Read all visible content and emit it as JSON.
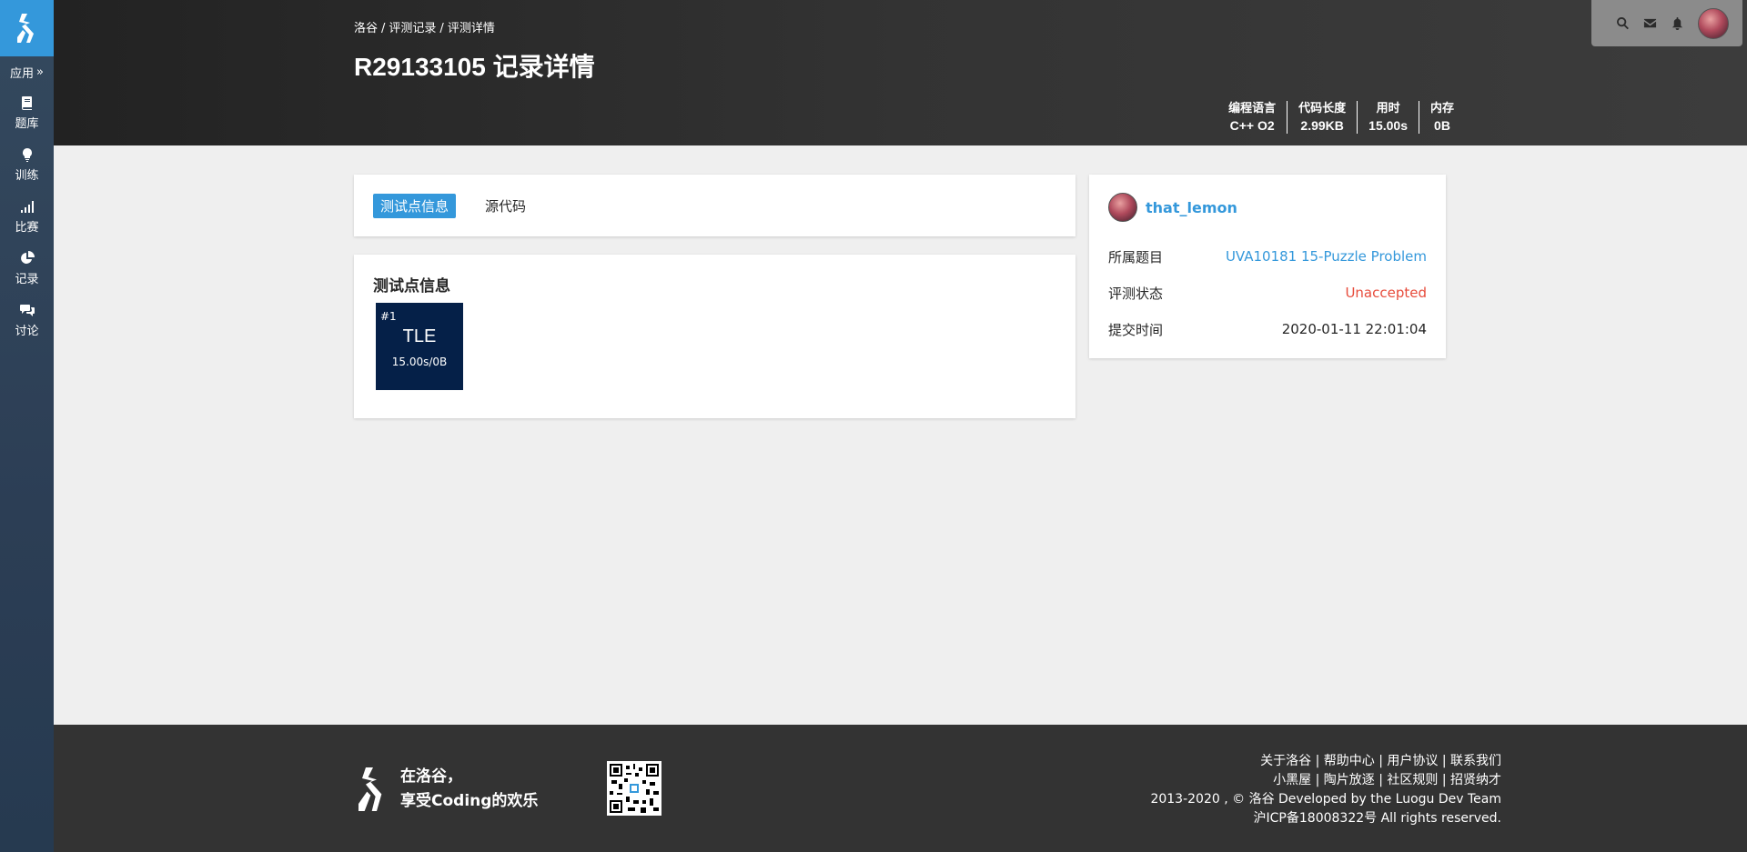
{
  "sidebar": {
    "app_label": "应用",
    "items": [
      {
        "label": "题库",
        "icon": "book-icon"
      },
      {
        "label": "训练",
        "icon": "lightbulb-icon"
      },
      {
        "label": "比赛",
        "icon": "bar-chart-icon"
      },
      {
        "label": "记录",
        "icon": "pie-chart-icon"
      },
      {
        "label": "讨论",
        "icon": "comments-icon"
      }
    ]
  },
  "header": {
    "breadcrumb": [
      "洛谷",
      "评测记录",
      "评测详情"
    ],
    "title": "R29133105 记录详情",
    "stats": [
      {
        "label": "编程语言",
        "value": "C++ O2"
      },
      {
        "label": "代码长度",
        "value": "2.99KB"
      },
      {
        "label": "用时",
        "value": "15.00s"
      },
      {
        "label": "内存",
        "value": "0B"
      }
    ]
  },
  "tabs": [
    "测试点信息",
    "源代码"
  ],
  "testcases": {
    "title": "测试点信息",
    "items": [
      {
        "num": "#1",
        "result": "TLE",
        "time_mem": "15.00s/0B"
      }
    ]
  },
  "info": {
    "username": "that_lemon",
    "rows": [
      {
        "label": "所属题目",
        "value": "UVA10181 15-Puzzle Problem"
      },
      {
        "label": "评测状态",
        "value": "Unaccepted"
      },
      {
        "label": "提交时间",
        "value": "2020-01-11 22:01:04"
      }
    ]
  },
  "footer": {
    "slogan_line1": "在洛谷，",
    "slogan_line2": "享受Coding的欢乐",
    "links_row1": [
      "关于洛谷",
      "帮助中心",
      "用户协议",
      "联系我们"
    ],
    "links_row2": [
      "小黑屋",
      "陶片放逐",
      "社区规则",
      "招贤纳才"
    ],
    "copyright_prefix": "2013-2020 , © 洛谷 Developed by the ",
    "team_link": "Luogu Dev Team",
    "icp": "沪ICP备18008322号 All rights reserved."
  },
  "colors": {
    "accent": "#3498db",
    "tle_bg": "#052048",
    "unaccepted": "#e74c3c"
  }
}
